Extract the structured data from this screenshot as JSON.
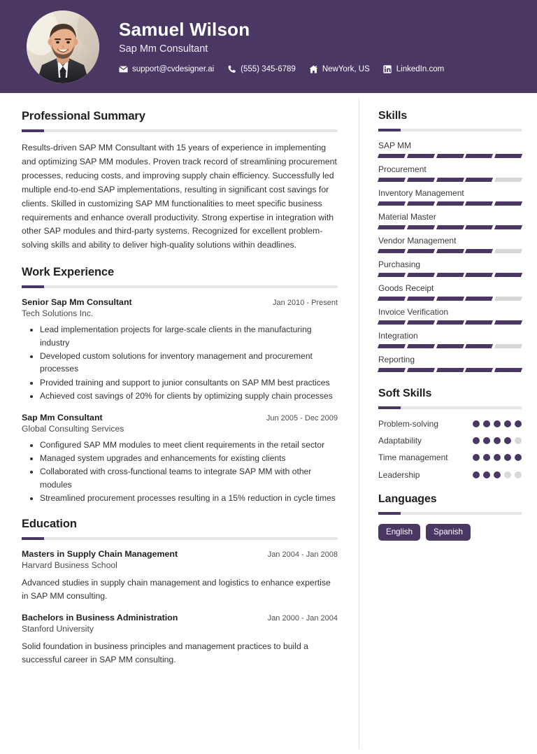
{
  "theme": {
    "accent": "#4b3764",
    "track": "#d6d6d6",
    "text": "#333333"
  },
  "header": {
    "name": "Samuel Wilson",
    "job_title": "Sap Mm Consultant",
    "avatar_alt": "profile-photo",
    "contacts": [
      {
        "icon": "envelope-icon",
        "text": "support@cvdesigner.ai"
      },
      {
        "icon": "phone-icon",
        "text": "(555) 345-6789"
      },
      {
        "icon": "home-icon",
        "text": "NewYork, US"
      },
      {
        "icon": "linkedin-icon",
        "text": "LinkedIn.com"
      }
    ]
  },
  "summary": {
    "heading": "Professional Summary",
    "text": "Results-driven SAP MM Consultant with 15 years of experience in implementing and optimizing SAP MM modules. Proven track record of streamlining procurement processes, reducing costs, and improving supply chain efficiency. Successfully led multiple end-to-end SAP implementations, resulting in significant cost savings for clients. Skilled in customizing SAP MM functionalities to meet specific business requirements and enhance overall productivity. Strong expertise in integration with other SAP modules and third-party systems. Recognized for excellent problem-solving skills and ability to deliver high-quality solutions within deadlines."
  },
  "experience": {
    "heading": "Work Experience",
    "entries": [
      {
        "role": "Senior Sap Mm Consultant",
        "date": "Jan 2010 - Present",
        "org": "Tech Solutions Inc.",
        "bullets": [
          "Lead implementation projects for large-scale clients in the manufacturing industry",
          "Developed custom solutions for inventory management and procurement processes",
          "Provided training and support to junior consultants on SAP MM best practices",
          "Achieved cost savings of 20% for clients by optimizing supply chain processes"
        ]
      },
      {
        "role": "Sap Mm Consultant",
        "date": "Jun 2005 - Dec 2009",
        "org": "Global Consulting Services",
        "bullets": [
          "Configured SAP MM modules to meet client requirements in the retail sector",
          "Managed system upgrades and enhancements for existing clients",
          "Collaborated with cross-functional teams to integrate SAP MM with other modules",
          "Streamlined procurement processes resulting in a 15% reduction in cycle times"
        ]
      }
    ]
  },
  "education": {
    "heading": "Education",
    "entries": [
      {
        "degree": "Masters in Supply Chain Management",
        "date": "Jan 2004 - Jan 2008",
        "school": "Harvard Business School",
        "description": "Advanced studies in supply chain management and logistics to enhance expertise in SAP MM consulting."
      },
      {
        "degree": "Bachelors in Business Administration",
        "date": "Jan 2000 - Jan 2004",
        "school": "Stanford University",
        "description": "Solid foundation in business principles and management practices to build a successful career in SAP MM consulting."
      }
    ]
  },
  "skills": {
    "heading": "Skills",
    "max": 5,
    "items": [
      {
        "label": "SAP MM",
        "level": 5
      },
      {
        "label": "Procurement",
        "level": 4
      },
      {
        "label": "Inventory Management",
        "level": 5
      },
      {
        "label": "Material Master",
        "level": 5
      },
      {
        "label": "Vendor Management",
        "level": 4
      },
      {
        "label": "Purchasing",
        "level": 5
      },
      {
        "label": "Goods Receipt",
        "level": 4
      },
      {
        "label": "Invoice Verification",
        "level": 5
      },
      {
        "label": "Integration",
        "level": 4
      },
      {
        "label": "Reporting",
        "level": 5
      }
    ]
  },
  "soft_skills": {
    "heading": "Soft Skills",
    "max": 5,
    "items": [
      {
        "label": "Problem-solving",
        "level": 5
      },
      {
        "label": "Adaptability",
        "level": 4
      },
      {
        "label": "Time management",
        "level": 5
      },
      {
        "label": "Leadership",
        "level": 3
      }
    ]
  },
  "languages": {
    "heading": "Languages",
    "items": [
      "English",
      "Spanish"
    ]
  }
}
